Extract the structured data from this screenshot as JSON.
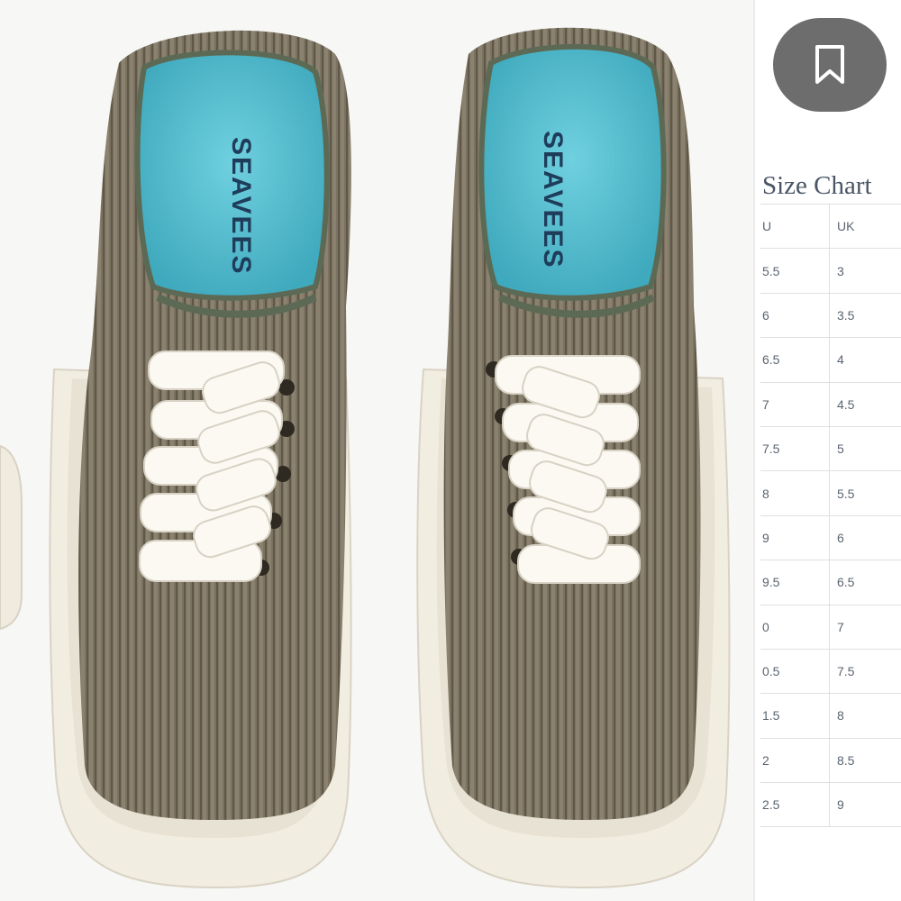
{
  "photo": {
    "alt": "Olive corduroy lace-up sneakers",
    "insole_brand": "SEAVEES"
  },
  "bookmark": {
    "icon": "bookmark-icon"
  },
  "size_chart": {
    "title": "Size Chart",
    "headers": [
      "U",
      "UK"
    ],
    "rows": [
      [
        "5.5",
        "3"
      ],
      [
        "6",
        "3.5"
      ],
      [
        "6.5",
        "4"
      ],
      [
        "7",
        "4.5"
      ],
      [
        "7.5",
        "5"
      ],
      [
        "8",
        "5.5"
      ],
      [
        "9",
        "6"
      ],
      [
        "9.5",
        "6.5"
      ],
      [
        "0",
        "7"
      ],
      [
        "0.5",
        "7.5"
      ],
      [
        "1.5",
        "8"
      ],
      [
        "2",
        "8.5"
      ],
      [
        "2.5",
        "9"
      ]
    ]
  },
  "colors": {
    "upper": "#7a7160",
    "insole": "#56c1d3",
    "sole": "#f1ece0",
    "laces": "#fbf9f1",
    "button": "#6d6d6d",
    "title": "#4a5566"
  }
}
